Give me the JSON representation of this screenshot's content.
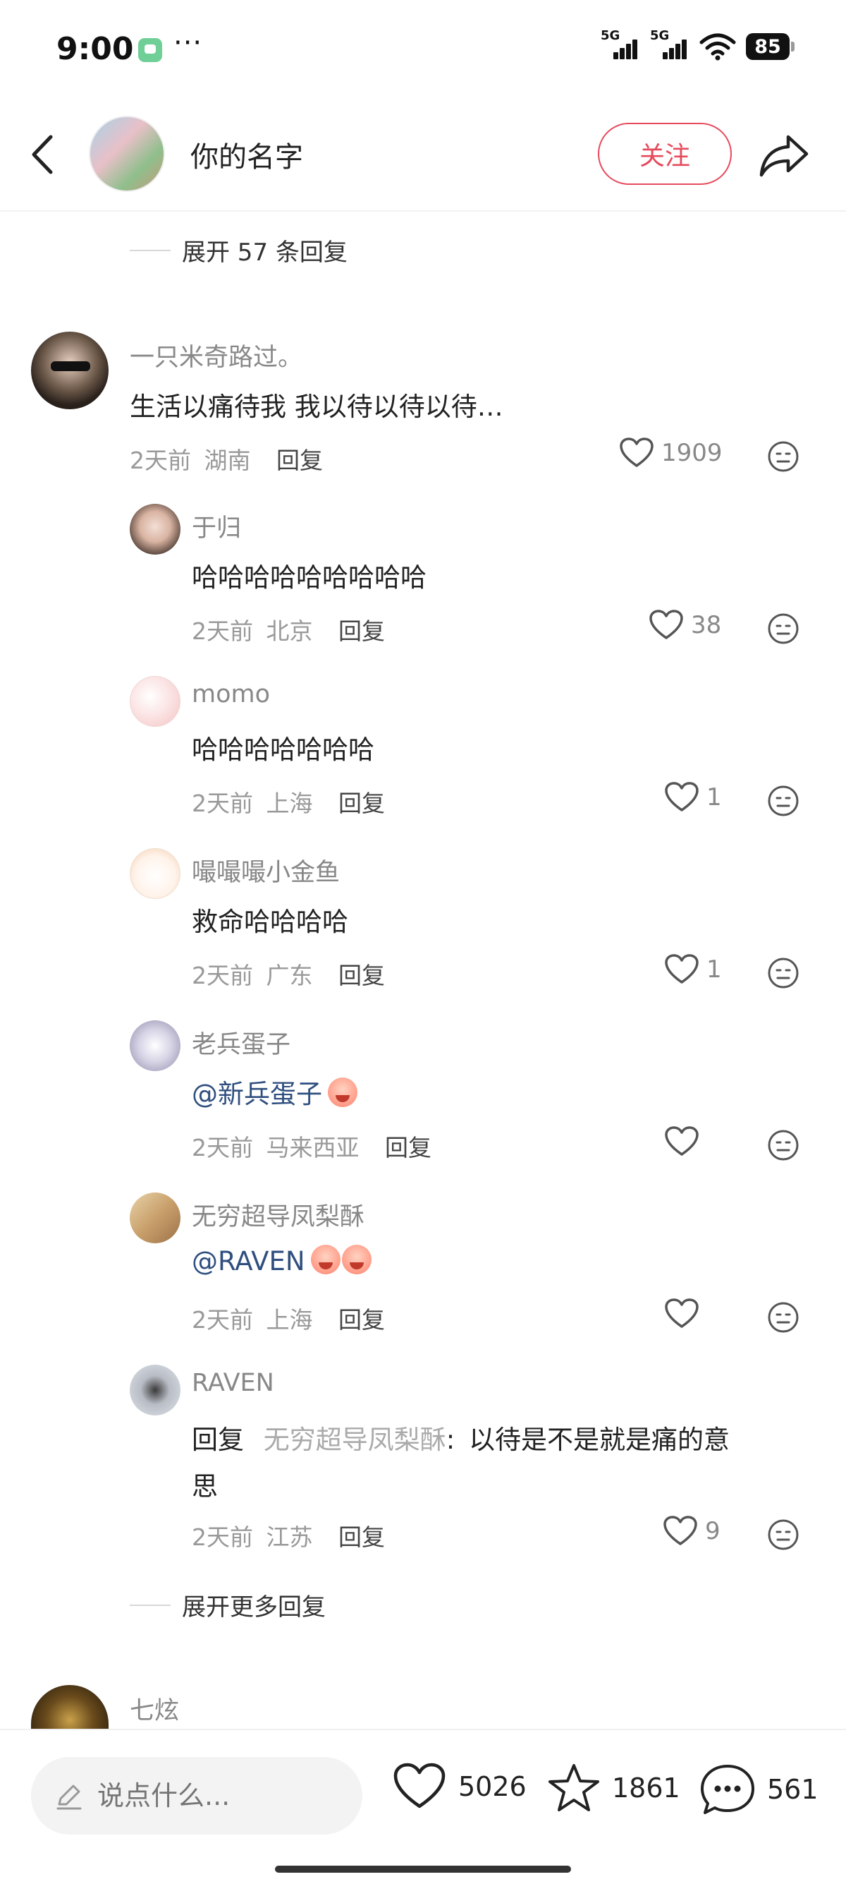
{
  "status": {
    "time": "9:00",
    "dots": "···",
    "signal1": "5G",
    "signal2": "5G",
    "battery": "85"
  },
  "header": {
    "name": "你的名字",
    "follow_label": "关注"
  },
  "top_expand": {
    "label": "展开 57 条回复"
  },
  "main_comment": {
    "username": "一只米奇路过。",
    "content": "生活以痛待我 我以待以待以待…",
    "time": "2天前",
    "location": "湖南",
    "reply_label": "回复",
    "likes": "1909"
  },
  "replies": [
    {
      "username": "于归",
      "content": "哈哈哈哈哈哈哈哈哈",
      "time": "2天前",
      "location": "北京",
      "reply_label": "回复",
      "likes": "38"
    },
    {
      "username": "momo",
      "content": "哈哈哈哈哈哈哈",
      "time": "2天前",
      "location": "上海",
      "reply_label": "回复",
      "likes": "1"
    },
    {
      "username": "嘬嘬嘬小金鱼",
      "content": "救命哈哈哈哈",
      "time": "2天前",
      "location": "广东",
      "reply_label": "回复",
      "likes": "1"
    },
    {
      "username": "老兵蛋子",
      "mention": "@新兵蛋子",
      "time": "2天前",
      "location": "马来西亚",
      "reply_label": "回复",
      "likes": ""
    },
    {
      "username": "无穷超导凤梨酥",
      "mention": "@RAVEN",
      "time": "2天前",
      "location": "上海",
      "reply_label": "回复",
      "likes": ""
    },
    {
      "username": "RAVEN",
      "reply_prefix": "回复",
      "reply_to": "无穷超导凤梨酥",
      "colon": ":",
      "content_line1": "以待是不是就是痛的意",
      "content_line2": "思",
      "time": "2天前",
      "location": "江苏",
      "reply_label": "回复",
      "likes": "9"
    }
  ],
  "more_expand": {
    "label": "展开更多回复"
  },
  "next_comment": {
    "username": "七炫"
  },
  "bottom_bar": {
    "placeholder": "说点什么...",
    "likes": "5026",
    "favorites": "1861",
    "comments": "561"
  },
  "colors": {
    "accent": "#e64a5c",
    "mention": "#2f4f7f"
  }
}
